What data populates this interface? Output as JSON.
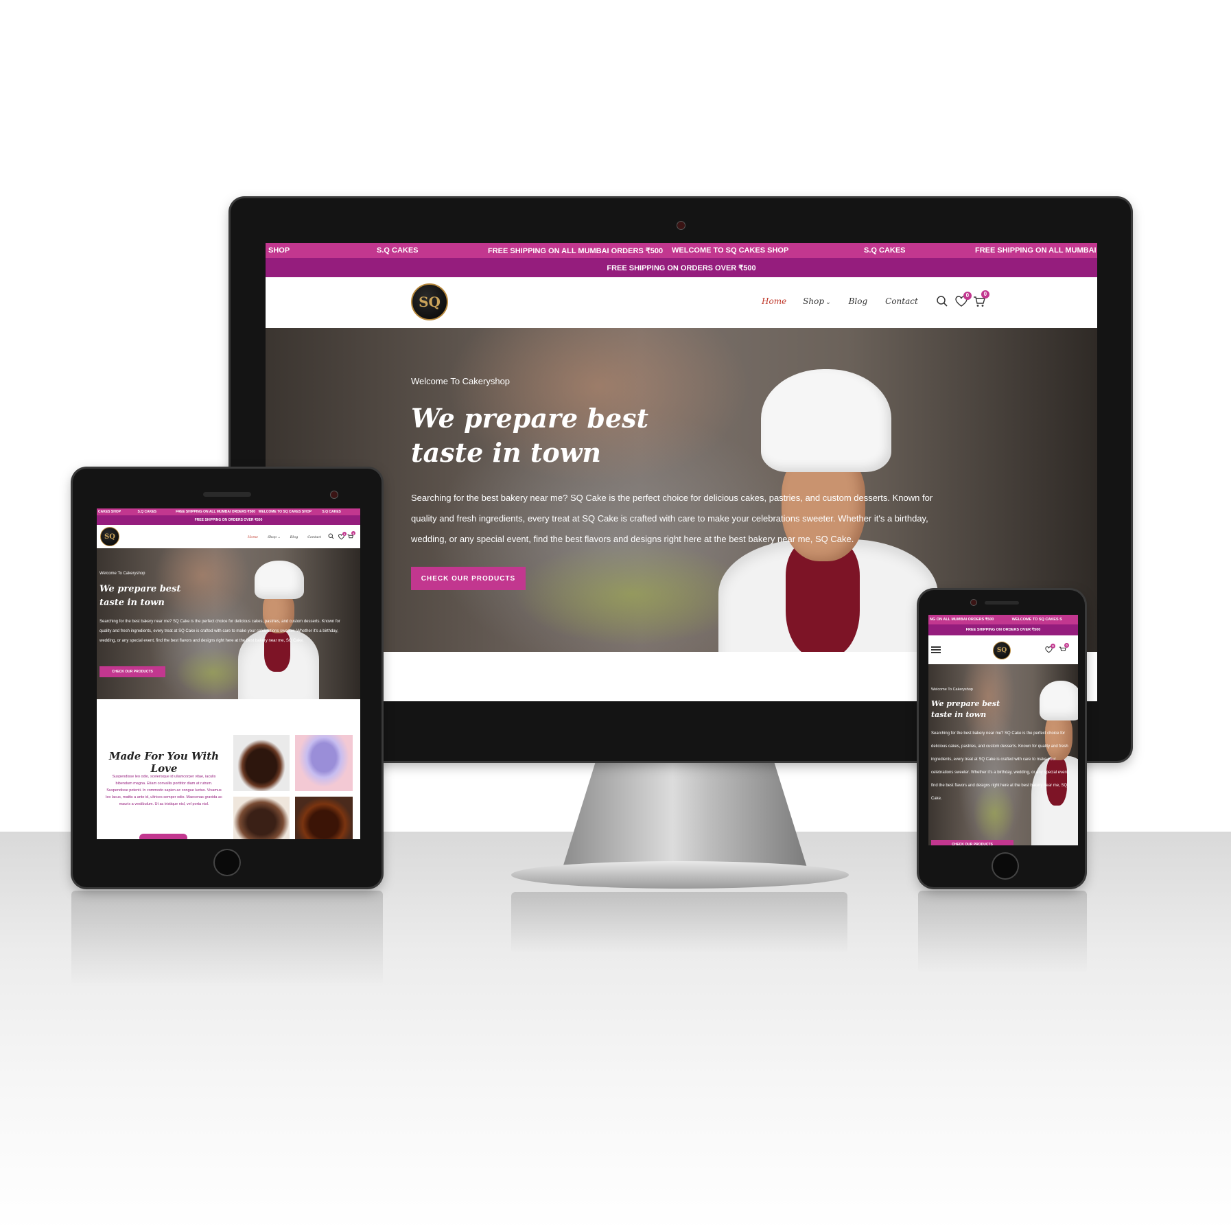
{
  "ticker": {
    "desktop": [
      "SHOP",
      "S.Q CAKES",
      "FREE SHIPPING ON ALL MUMBAI ORDERS ₹500",
      "WELCOME TO SQ CAKES SHOP",
      "S.Q CAKES",
      "FREE SHIPPING ON ALL MUMBAI C"
    ],
    "tablet": [
      "CAKES SHOP",
      "S.Q CAKES",
      "FREE SHIPPING ON ALL MUMBAI ORDERS ₹500",
      "WELCOME TO SQ CAKES SHOP",
      "S.Q CAKES"
    ],
    "phone": [
      "NG ON ALL MUMBAI ORDERS ₹500",
      "WELCOME TO SQ CAKES S"
    ]
  },
  "shipping_bar": "FREE SHIPPING ON ORDERS OVER ₹500",
  "logo_text": "SQ",
  "nav": {
    "home": "Home",
    "shop": "Shop",
    "blog": "Blog",
    "contact": "Contact"
  },
  "wishlist_count": "0",
  "cart_count": "0",
  "hero": {
    "eyebrow": "Welcome To Cakeryshop",
    "title_line1": "We prepare best",
    "title_line2": "taste in town",
    "body": "Searching for the best bakery near me? SQ Cake is the perfect choice for delicious cakes, pastries, and custom desserts. Known for quality and fresh ingredients, every treat at SQ Cake is crafted with care to make your celebrations sweeter. Whether it's a birthday, wedding, or any special event, find the best flavors and designs right here at the best bakery near me, SQ Cake.",
    "cta": "CHECK OUR PRODUCTS"
  },
  "section": {
    "title": "Made For You With Love",
    "body": "Suspendisse leo odio, scelerisque id ullamcorper vitae, iaculis bibendum magna. Etiam convallis porttitor diam at rutrum. Suspendisse potenti. In commodo sapien ac congue luctus. Vivamus leo lacus, mattis a ante id, ultrices semper odio. Maecenas gravida ac mauris a vestibulum. Ut ac tristique nisl, vel porta nisl."
  },
  "colors": {
    "ticker": "#c2378f",
    "shipping_bar": "#951d7d",
    "accent": "#c2378f",
    "nav_active": "#c0392b"
  }
}
